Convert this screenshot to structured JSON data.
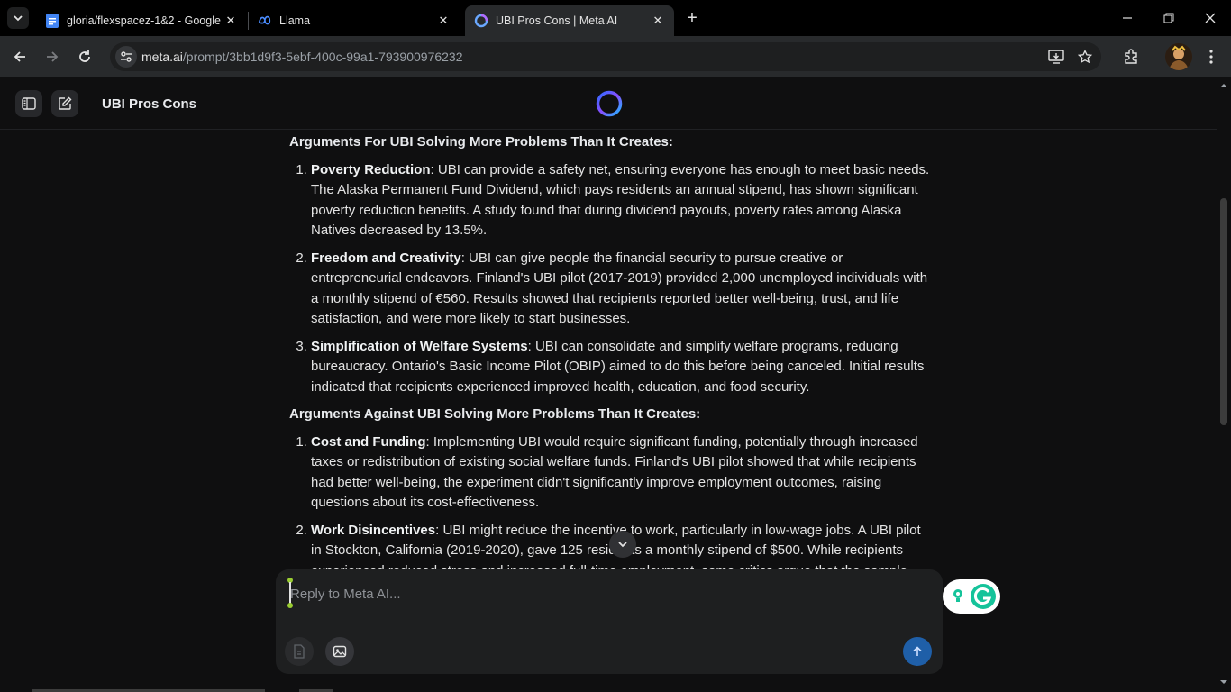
{
  "browser": {
    "tabs": [
      {
        "title": "gloria/flexspacez-1&2 - Google",
        "icon": "google-docs-icon"
      },
      {
        "title": "Llama",
        "icon": "meta-logo-icon"
      },
      {
        "title": "UBI Pros Cons | Meta AI",
        "icon": "meta-ai-ring-icon"
      }
    ],
    "url_domain": "meta.ai",
    "url_path": "/prompt/3bb1d9f3-5ebf-400c-99a1-793900976232"
  },
  "app": {
    "conversation_title": "UBI Pros Cons"
  },
  "message": {
    "section1_heading": "Arguments For UBI Solving More Problems Than It Creates:",
    "section1_items": [
      {
        "title": "Poverty Reduction",
        "text": ": UBI can provide a safety net, ensuring everyone has enough to meet basic needs. The Alaska Permanent Fund Dividend, which pays residents an annual stipend, has shown significant poverty reduction benefits. A study found that during dividend payouts, poverty rates among Alaska Natives decreased by 13.5%."
      },
      {
        "title": "Freedom and Creativity",
        "text": ": UBI can give people the financial security to pursue creative or entrepreneurial endeavors. Finland's UBI pilot (2017-2019) provided 2,000 unemployed individuals with a monthly stipend of €560. Results showed that recipients reported better well-being, trust, and life satisfaction, and were more likely to start businesses."
      },
      {
        "title": "Simplification of Welfare Systems",
        "text": ": UBI can consolidate and simplify welfare programs, reducing bureaucracy. Ontario's Basic Income Pilot (OBIP) aimed to do this before being canceled. Initial results indicated that recipients experienced improved health, education, and food security."
      }
    ],
    "section2_heading": "Arguments Against UBI Solving More Problems Than It Creates:",
    "section2_items": [
      {
        "title": "Cost and Funding",
        "text": ": Implementing UBI would require significant funding, potentially through increased taxes or redistribution of existing social welfare funds. Finland's UBI pilot showed that while recipients had better well-being, the experiment didn't significantly improve employment outcomes, raising questions about its cost-effectiveness."
      },
      {
        "title": "Work Disincentives",
        "text": ": UBI might reduce the incentive to work, particularly in low-wage jobs. A UBI pilot in Stockton, California (2019-2020), gave 125 residents a monthly stipend of $500. While recipients experienced reduced stress and increased full-time employment, some critics argue that the sample"
      }
    ]
  },
  "composer": {
    "placeholder": "Reply to Meta AI..."
  },
  "colors": {
    "page_bg": "#0f0f10",
    "chrome_bg": "#000000",
    "toolbar_bg": "#282a2c",
    "send_button": "#1f5fa8",
    "grammarly_green": "#15c39a"
  }
}
